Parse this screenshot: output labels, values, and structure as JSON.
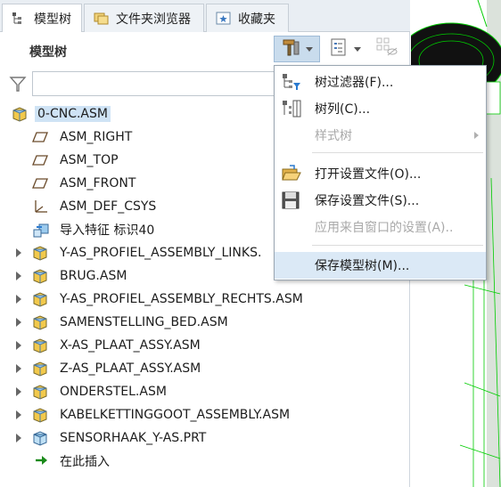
{
  "tabs": [
    {
      "label": "模型树",
      "icon": "model-tree-icon",
      "active": true
    },
    {
      "label": "文件夹浏览器",
      "icon": "folder-browser-icon",
      "active": false
    },
    {
      "label": "收藏夹",
      "icon": "favorites-icon",
      "active": false
    }
  ],
  "panel": {
    "title": "模型树"
  },
  "filter": {
    "placeholder": "",
    "value": ""
  },
  "tree": [
    {
      "label": "0-CNC.ASM",
      "icon": "assembly-icon",
      "expander": false,
      "selected": true
    },
    {
      "label": "ASM_RIGHT",
      "icon": "datum-plane-icon",
      "expander": false
    },
    {
      "label": "ASM_TOP",
      "icon": "datum-plane-icon",
      "expander": false
    },
    {
      "label": "ASM_FRONT",
      "icon": "datum-plane-icon",
      "expander": false
    },
    {
      "label": "ASM_DEF_CSYS",
      "icon": "csys-icon",
      "expander": false
    },
    {
      "label": "导入特征 标识40",
      "icon": "import-feature-icon",
      "expander": false
    },
    {
      "label": "Y-AS_PROFIEL_ASSEMBLY_LINKS.",
      "icon": "assembly-icon",
      "expander": true
    },
    {
      "label": "BRUG.ASM",
      "icon": "assembly-icon",
      "expander": true
    },
    {
      "label": "Y-AS_PROFIEL_ASSEMBLY_RECHTS.ASM",
      "icon": "assembly-icon",
      "expander": true
    },
    {
      "label": "SAMENSTELLING_BED.ASM",
      "icon": "assembly-icon",
      "expander": true
    },
    {
      "label": "X-AS_PLAAT_ASSY.ASM",
      "icon": "assembly-icon",
      "expander": true
    },
    {
      "label": "Z-AS_PLAAT_ASSY.ASM",
      "icon": "assembly-icon",
      "expander": true
    },
    {
      "label": "ONDERSTEL.ASM",
      "icon": "assembly-icon",
      "expander": true
    },
    {
      "label": "KABELKETTINGGOOT_ASSEMBLY.ASM",
      "icon": "assembly-icon",
      "expander": true
    },
    {
      "label": "SENSORHAAK_Y-AS.PRT",
      "icon": "part-icon",
      "expander": true
    },
    {
      "label": "在此插入",
      "icon": "insert-here-arrow-icon",
      "expander": false
    }
  ],
  "menu": {
    "items": [
      {
        "label": "树过滤器(F)...",
        "icon": "tree-filter-icon",
        "disabled": false
      },
      {
        "label": "树列(C)...",
        "icon": "tree-columns-icon",
        "disabled": false
      },
      {
        "label": "样式树",
        "icon": "",
        "disabled": true,
        "submenu": true
      },
      {
        "label": "打开设置文件(O)...",
        "icon": "open-folder-icon",
        "disabled": false
      },
      {
        "label": "保存设置文件(S)...",
        "icon": "save-disk-icon",
        "disabled": false
      },
      {
        "label": "应用来自窗口的设置(A)..",
        "icon": "",
        "disabled": true
      },
      {
        "label": "保存模型树(M)...",
        "icon": "",
        "disabled": false,
        "highlighted": true
      }
    ]
  },
  "colors": {
    "accent": "#cfe3f5",
    "assembly": "#f2c94c",
    "viewport_lines": "#00cc00"
  }
}
